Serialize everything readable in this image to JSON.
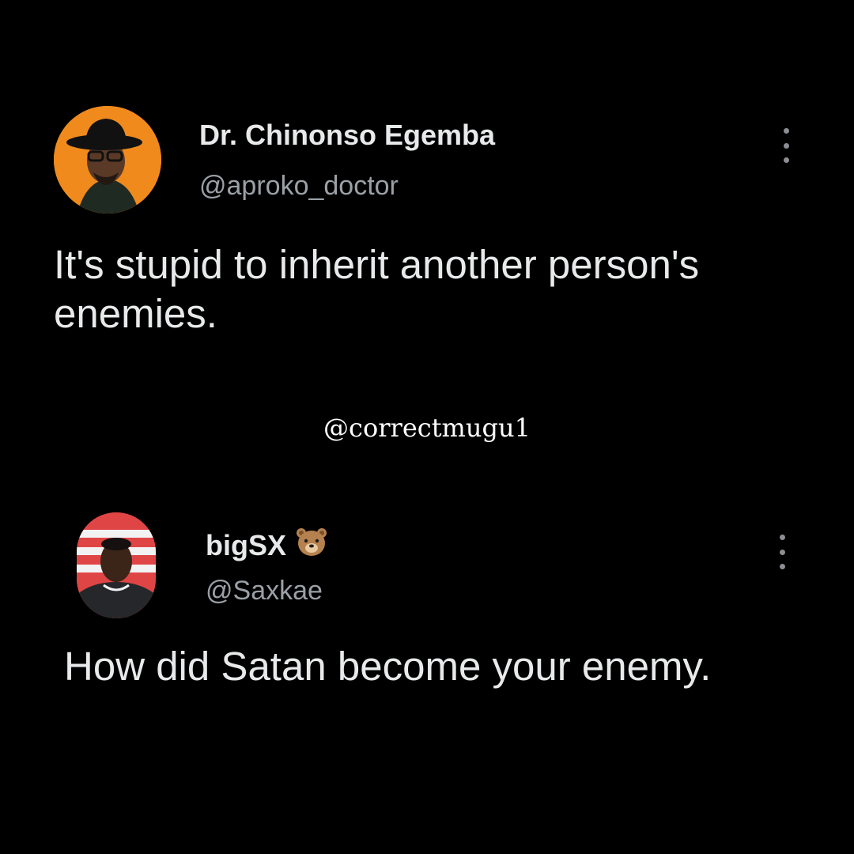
{
  "tweets": [
    {
      "display_name": "Dr. Chinonso Egemba",
      "handle": "@aproko_doctor",
      "text": "It's stupid to inherit another person's enemies.",
      "more_icon": "ellipsis-vertical-icon",
      "avatar_bg": "#f08a1c"
    },
    {
      "display_name": "bigSX",
      "name_emoji": "bear-face-emoji",
      "handle": "@Saxkae",
      "text": "How did Satan become your enemy.",
      "more_icon": "ellipsis-vertical-icon",
      "avatar_bg": "#d83a3a"
    }
  ],
  "watermark": "@correctmugu1",
  "colors": {
    "background": "#000000",
    "name": "#e7e9ea",
    "handle": "#9aa0a6"
  }
}
